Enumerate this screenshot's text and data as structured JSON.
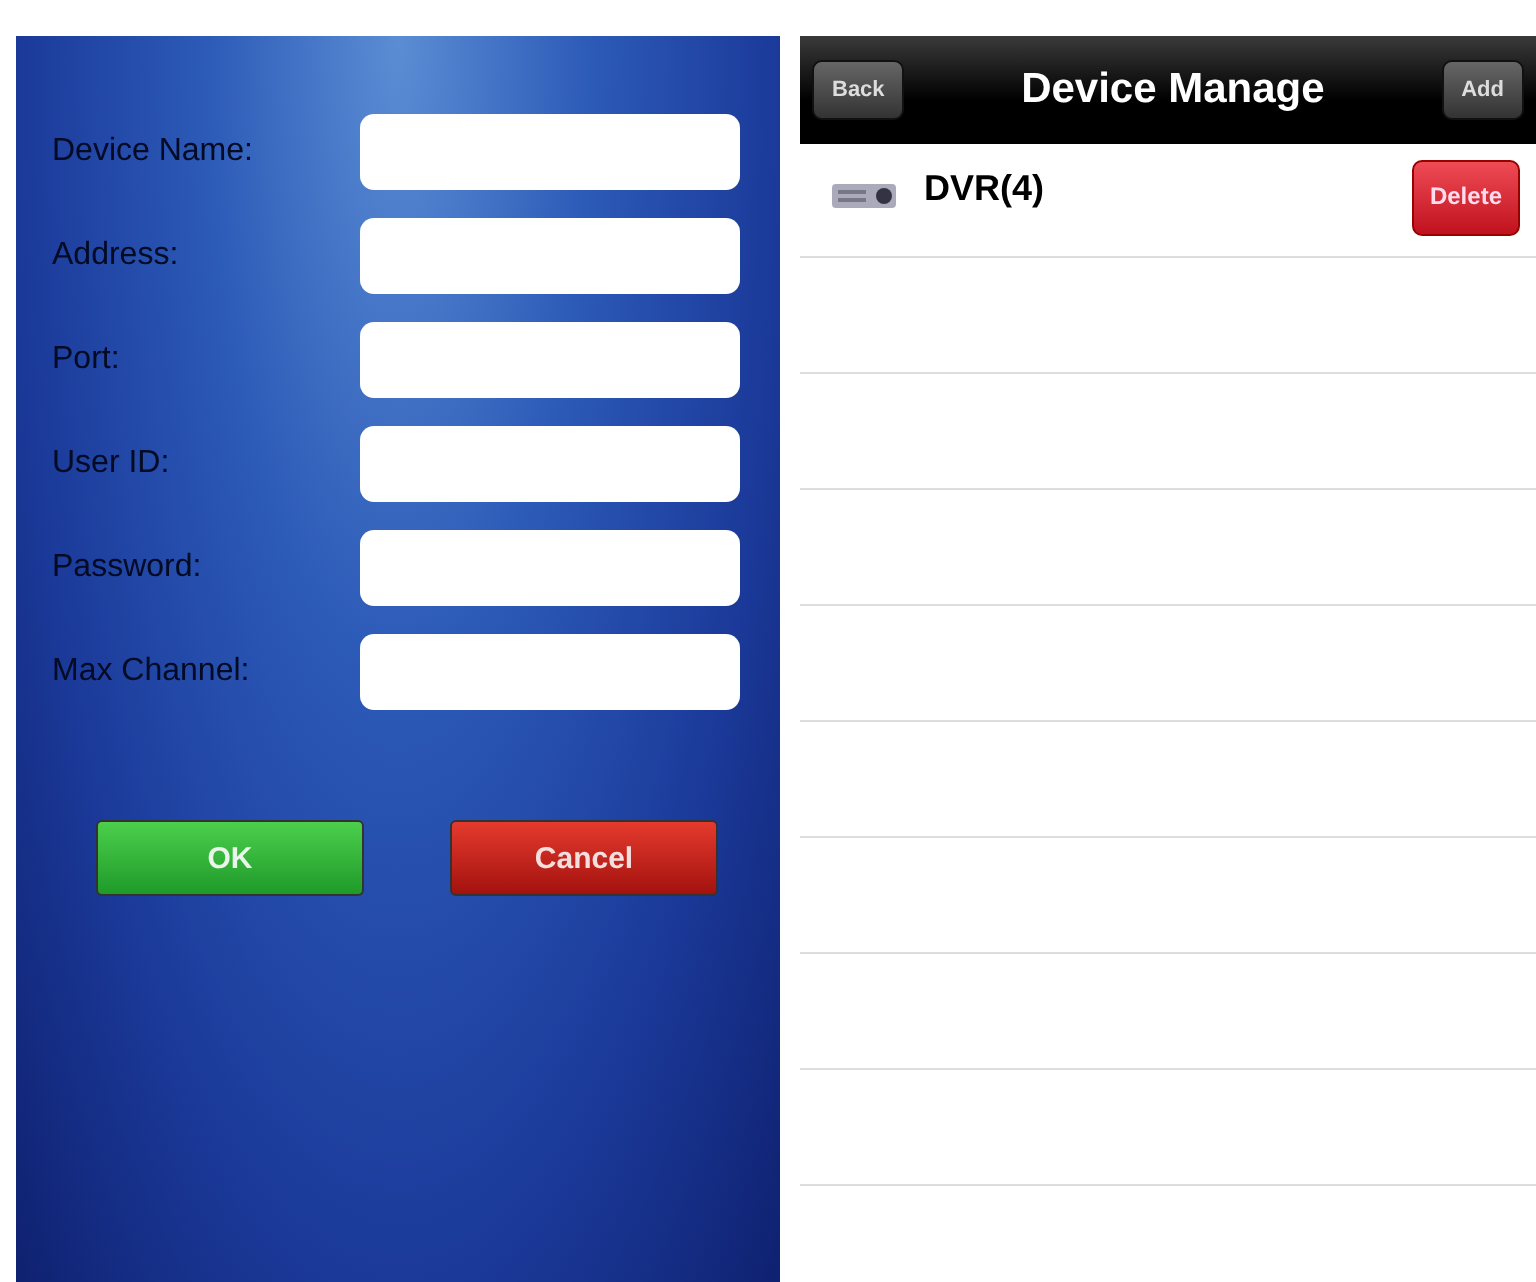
{
  "form": {
    "fields": [
      {
        "label": "Device Name:"
      },
      {
        "label": "Address:"
      },
      {
        "label": "Port:"
      },
      {
        "label": "User ID:"
      },
      {
        "label": "Password:"
      },
      {
        "label": "Max Channel:"
      }
    ],
    "buttons": [
      {
        "label": "OK",
        "kind": "confirm"
      },
      {
        "label": "Cancel",
        "kind": "cancel"
      }
    ]
  },
  "device_manage": {
    "title": "Device Manage",
    "back": "Back",
    "add": "Add",
    "devices": [
      {
        "name": "DVR(4)",
        "action": "Delete"
      }
    ]
  }
}
